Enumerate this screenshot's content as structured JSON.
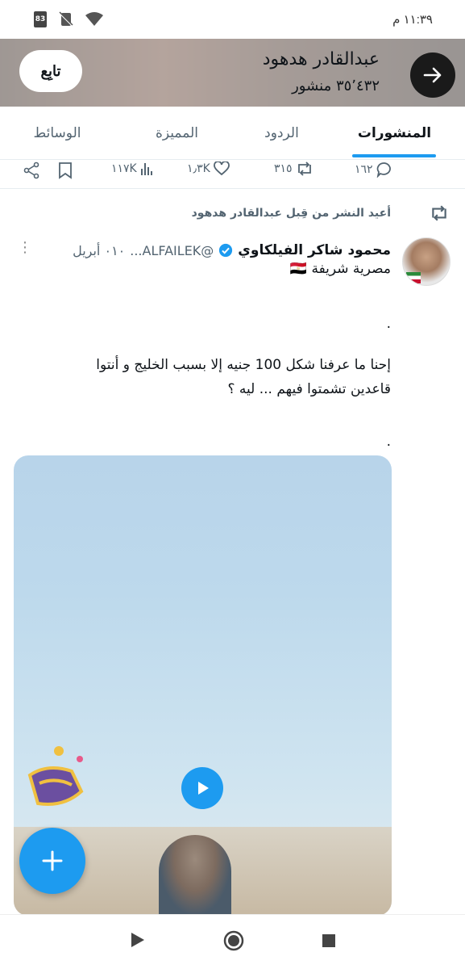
{
  "status_bar": {
    "time": "١١:٣٩ م",
    "battery": "83",
    "icons": [
      "wifi-icon",
      "no-sim-icon",
      "battery-icon"
    ]
  },
  "header": {
    "name": "عبدالقادر هدهود",
    "post_count": "٣٥٬٤٣٢ منشور",
    "follow_label": "تابِع"
  },
  "tabs": [
    {
      "label": "المنشورات",
      "active": true
    },
    {
      "label": "الردود",
      "active": false
    },
    {
      "label": "المميزة",
      "active": false
    },
    {
      "label": "الوسائط",
      "active": false
    }
  ],
  "prev_actions": {
    "replies": "١٦٢",
    "reposts": "٣١٥",
    "likes": "١٫٣K",
    "views": "١١٧K"
  },
  "post": {
    "repost_label": "أعيد النشر من قِبل عبدالقادر هدهود",
    "author_name": "محمود شاكر الفيلكاوي",
    "handle": "@ALFAILEK...",
    "date": "٠١٠ أبريل",
    "bio": "مصرية شريفة 🇪🇬",
    "dot1": ".",
    "line1": "إحنا ما عرفنا شكل 100 جنيه إلا بسبب الخليج و أنتوا",
    "line2": "قاعدين تشمتوا فيهم ... ليه ؟",
    "dot2": "."
  },
  "colors": {
    "accent": "#1d9bf0",
    "text": "#0f1419",
    "muted": "#536471"
  }
}
